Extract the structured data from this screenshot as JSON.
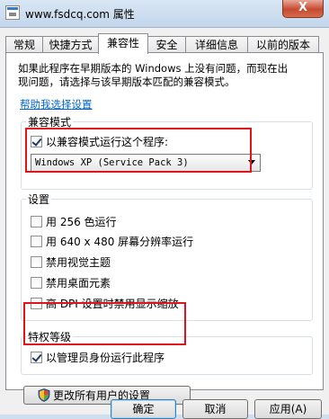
{
  "window": {
    "title": "www.fsdcq.com 属性",
    "close_glyph": "X"
  },
  "tabs": [
    {
      "label": "常规",
      "active": false
    },
    {
      "label": "快捷方式",
      "active": false
    },
    {
      "label": "兼容性",
      "active": true
    },
    {
      "label": "安全",
      "active": false
    },
    {
      "label": "详细信息",
      "active": false
    },
    {
      "label": "以前的版本",
      "active": false
    }
  ],
  "intro": {
    "line1": "如果此程序在早期版本的 Windows 上没有问题，而现在出",
    "line2": "现问题，请选择与该早期版本匹配的兼容模式。"
  },
  "help_link": "帮助我选择设置",
  "compat_mode": {
    "title": "兼容模式",
    "checkbox_label": "以兼容模式运行这个程序:",
    "checked": true,
    "selected_os": "Windows XP (Service Pack 3)"
  },
  "settings": {
    "title": "设置",
    "items": [
      {
        "label": "用 256 色运行",
        "checked": false
      },
      {
        "label": "用 640 x 480 屏幕分辨率运行",
        "checked": false
      },
      {
        "label": "禁用视觉主题",
        "checked": false
      },
      {
        "label": "禁用桌面元素",
        "checked": false
      },
      {
        "label": "高 DPI 设置时禁用显示缩放",
        "checked": false
      }
    ]
  },
  "privilege": {
    "title": "特权等级",
    "checkbox_label": "以管理员身份运行此程序",
    "checked": true
  },
  "all_users_button": "更改所有用户的设置",
  "buttons": {
    "ok": "确定",
    "cancel": "取消",
    "apply": "应用(A)"
  },
  "colors": {
    "highlight": "#e0141b",
    "link": "#0066cc"
  },
  "icons": {
    "shield": "uac-shield-icon"
  }
}
